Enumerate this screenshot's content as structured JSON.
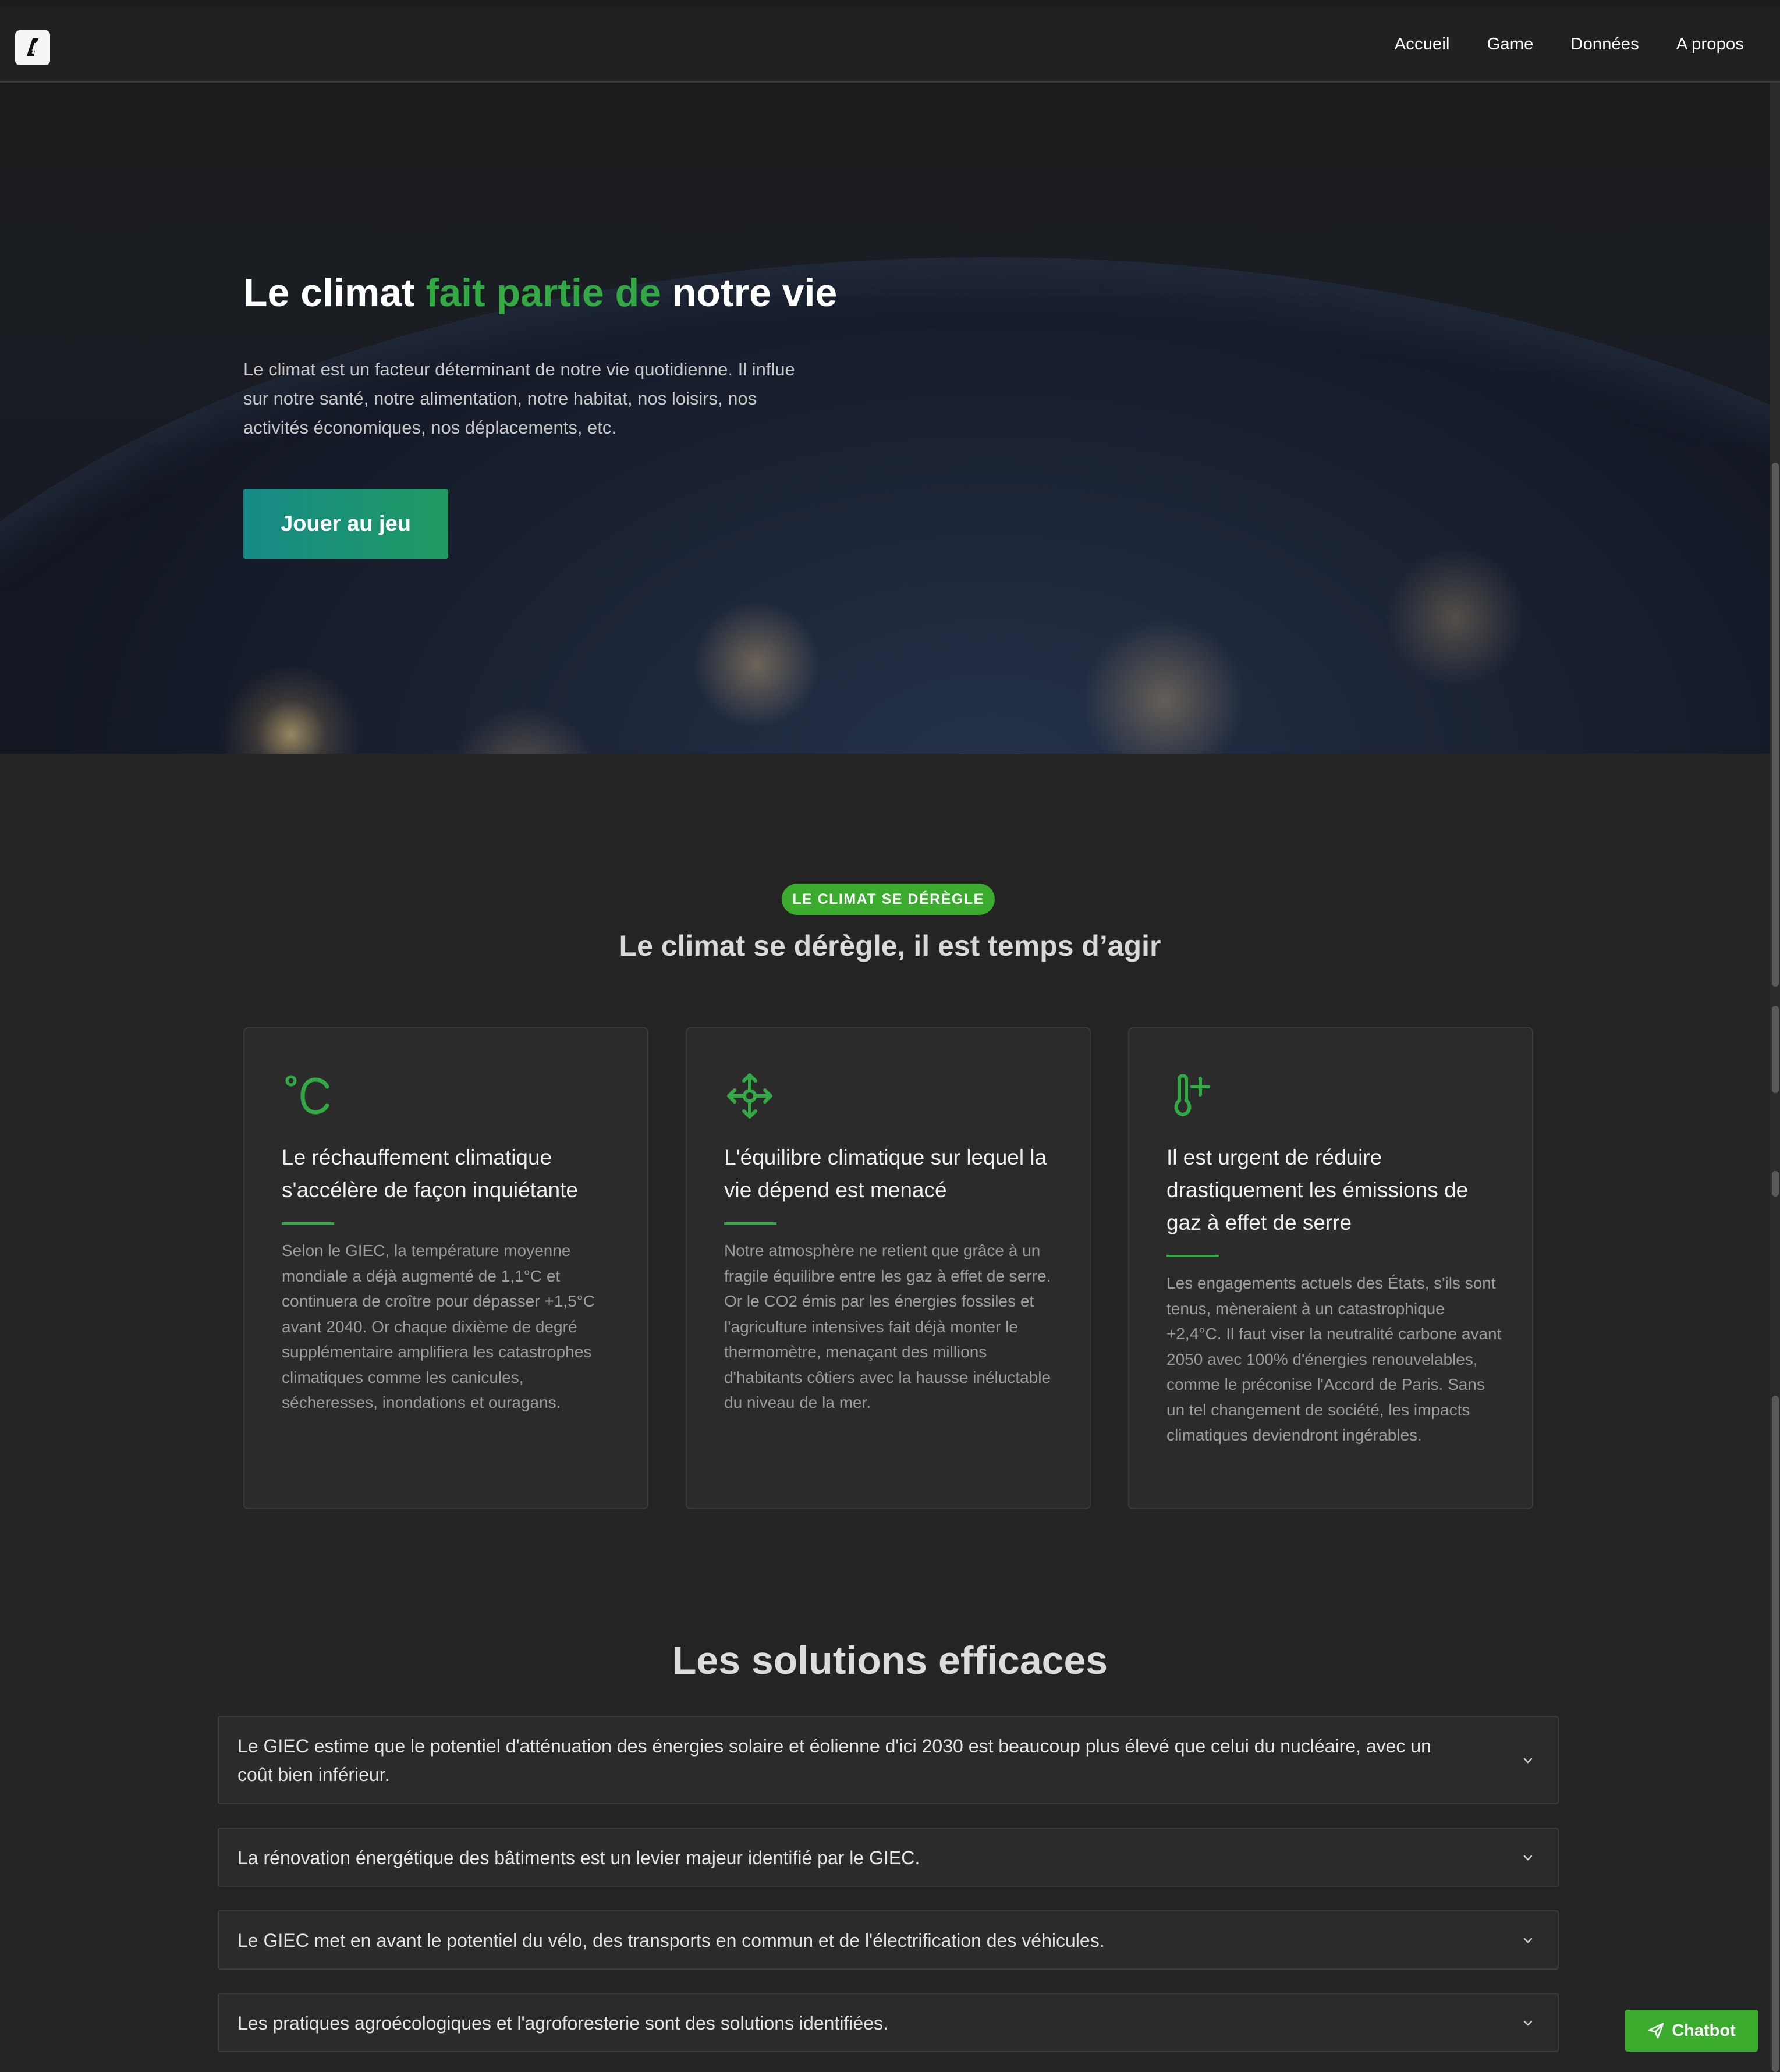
{
  "nav": {
    "logo_icon": "site-logo-icon",
    "links": [
      "Accueil",
      "Game",
      "Données",
      "A propos"
    ]
  },
  "hero": {
    "title_part1": "Le climat ",
    "title_accent": "fait partie de",
    "title_part2": " notre vie",
    "description": "Le climat est un facteur déterminant de notre vie quotidienne. Il influe sur notre santé, notre alimentation, notre habitat, nos loisirs, nos activités économiques, nos déplacements, etc.",
    "button_label": "Jouer au jeu"
  },
  "climate_section": {
    "badge": "LE CLIMAT SE DÉRÈGLE",
    "title": "Le climat se dérègle, il est temps d’agir",
    "cards": [
      {
        "icon": "celsius-icon",
        "title": "Le réchauffement climatique s'accélère de façon inquiétante",
        "text": "Selon le GIEC, la température moyenne mondiale a déjà augmenté de 1,1°C et continuera de croître pour dépasser +1,5°C avant 2040. Or chaque dixième de degré supplémentaire amplifiera les catastrophes climatiques comme les canicules, sécheresses, inondations et ouragans."
      },
      {
        "icon": "arrows-expand-icon",
        "title": "L'équilibre climatique sur lequel la vie dépend est menacé",
        "text": "Notre atmosphère ne retient que grâce à un fragile équilibre entre les gaz à effet de serre. Or le CO2 émis par les énergies fossiles et l'agriculture intensives fait déjà monter le thermomètre, menaçant des millions d'habitants côtiers avec la hausse inéluctable du niveau de la mer."
      },
      {
        "icon": "thermometer-plus-icon",
        "title": "Il est urgent de réduire drastiquement les émissions de gaz à effet de serre",
        "text": "Les engagements actuels des États, s'ils sont tenus, mèneraient à un catastrophique +2,4°C. Il faut viser la neutralité carbone avant 2050 avec 100% d'énergies renouvelables, comme le préconise l'Accord de Paris. Sans un tel changement de société, les impacts climatiques deviendront ingérables."
      }
    ]
  },
  "solutions": {
    "title": "Les solutions efficaces",
    "items": [
      "Le GIEC estime que le potentiel d'atténuation des énergies solaire et éolienne d'ici 2030 est beaucoup plus élevé que celui du nucléaire, avec un coût bien inférieur.",
      "La rénovation énergétique des bâtiments est un levier majeur identifié par le GIEC.",
      "Le GIEC met en avant le potentiel du vélo, des transports en commun et de l'électrification des véhicules.",
      "Les pratiques agroécologiques et l'agroforesterie sont des solutions identifiées."
    ]
  },
  "chatbot": {
    "label": "Chatbot",
    "icon": "send-icon"
  },
  "colors": {
    "accent_green": "#33a945",
    "badge_green": "#3bab2d",
    "button_gradient_start": "#168a87",
    "button_gradient_end": "#1f9a62",
    "background": "#242424",
    "card_background": "#2b2b2b"
  }
}
